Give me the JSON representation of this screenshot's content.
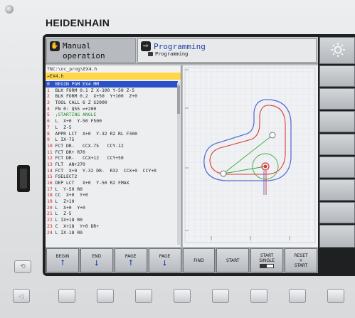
{
  "brand": "HEIDENHAIN",
  "header": {
    "manual_mode": "Manual operation",
    "programming_title": "Programming",
    "programming_sub": "Programming"
  },
  "program": {
    "path": "TNC:\\nc_prog\\EX4.h",
    "file": "→EX4.h",
    "lines": [
      {
        "n": "0",
        "text": "  BEGIN PGM EX4 MM",
        "selected": true
      },
      {
        "n": "1",
        "text": "  BLK FORM 0.1 Z X-100 Y-50 Z-5"
      },
      {
        "n": "2",
        "text": "  BLK FORM 0.2  X+50  Y+100  Z+0"
      },
      {
        "n": "3",
        "text": "  TOOL CALL 6 Z S2000"
      },
      {
        "n": "4",
        "text": "  FN 0: Q55 =+200"
      },
      {
        "n": "5",
        "text": "  ;STARTING ANGLE"
      },
      {
        "n": "6",
        "text": "  L  X+0  Y-50 F500"
      },
      {
        "n": "7",
        "text": "  L  Z-5"
      },
      {
        "n": "8",
        "text": "  APPR LCT  X+0  Y-32 R2 RL F300"
      },
      {
        "n": "9",
        "text": "  L IX-75"
      },
      {
        "n": "10",
        "text": " FCT DR-   CCX-75   CCY-12"
      },
      {
        "n": "11",
        "text": " FCT DR+ R70"
      },
      {
        "n": "12",
        "text": " FCT DR-   CCX+12   CCY+50"
      },
      {
        "n": "13",
        "text": " FLT  AN+270"
      },
      {
        "n": "14",
        "text": " FCT  X+0  Y-32 DR-  R32  CCX+0  CCY+0"
      },
      {
        "n": "15",
        "text": " FSELECT2"
      },
      {
        "n": "16",
        "text": " DEP LCT   X+0  Y-50 R2 FMAX"
      },
      {
        "n": "17",
        "text": " L  Y-50 R0"
      },
      {
        "n": "18",
        "text": " CC  X+0  Y+0"
      },
      {
        "n": "19",
        "text": " L  Z+10"
      },
      {
        "n": "20",
        "text": " L  X+0  Y+0"
      },
      {
        "n": "21",
        "text": " L  Z-5"
      },
      {
        "n": "22",
        "text": " L IX+18 R0"
      },
      {
        "n": "23",
        "text": " C  X+18  Y+0 DR+"
      },
      {
        "n": "24",
        "text": " L IX-18 R0"
      }
    ]
  },
  "softkeys": [
    {
      "line1": "BEGIN",
      "line2": "",
      "icon": "arrow-up-icon"
    },
    {
      "line1": "END",
      "line2": "",
      "icon": "arrow-down-icon"
    },
    {
      "line1": "PAGE",
      "line2": "",
      "icon": "arrow-up-icon"
    },
    {
      "line1": "PAGE",
      "line2": "",
      "icon": "arrow-down-icon"
    },
    {
      "line1": "FIND",
      "line2": "",
      "icon": ""
    },
    {
      "line1": "START",
      "line2": "",
      "icon": ""
    },
    {
      "line1": "START",
      "line2": "SINGLE",
      "icon": "toggle-icon"
    },
    {
      "line1": "RESET",
      "line2": "+",
      "line3": "START",
      "icon": ""
    }
  ],
  "colors": {
    "selection": "#2a52c6",
    "file_bar": "#ffd84a",
    "contour_blue": "#5a6fd8",
    "contour_red": "#d83a3a",
    "toolpath_green": "#3aa83a"
  }
}
